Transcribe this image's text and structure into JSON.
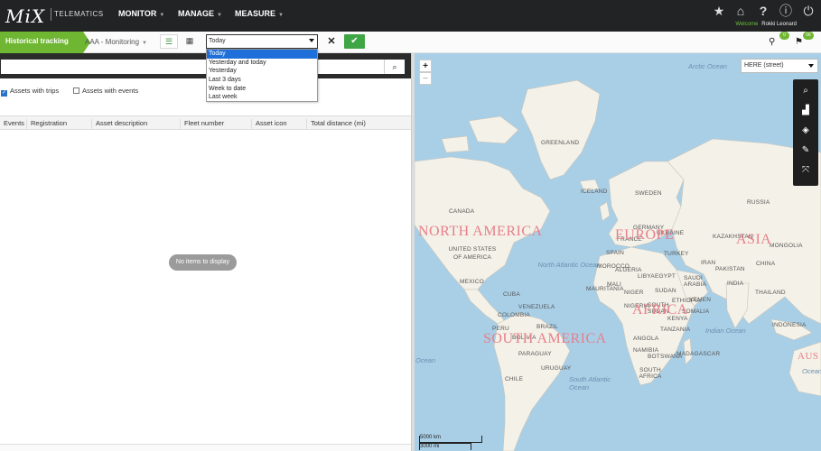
{
  "header": {
    "logo_text": "MiX",
    "logo_sub": "TELEMATICS",
    "nav": [
      {
        "label": "MONITOR"
      },
      {
        "label": "MANAGE"
      },
      {
        "label": "MEASURE"
      }
    ],
    "welcome_label": "Welcome",
    "user_name": "Rokki Leonard",
    "icons": [
      "star-icon",
      "home-icon",
      "help-icon",
      "info-icon",
      "power-icon"
    ]
  },
  "toolbar": {
    "module_title": "Historical tracking",
    "group_select": "AAA - Monitoring",
    "date_select_value": "Today",
    "marker_badge": "0",
    "flag_badge": "06"
  },
  "date_dropdown": {
    "options": [
      "Today",
      "Yesterday and today",
      "Yesterday",
      "Last 3 days",
      "Week to date",
      "Last week"
    ],
    "selected_index": 0
  },
  "left_panel": {
    "search_placeholder": "",
    "filters": [
      {
        "label": "Assets with trips",
        "checked": true
      },
      {
        "label": "Assets with events",
        "checked": false
      }
    ],
    "columns": [
      "Events",
      "Registration",
      "Asset description",
      "Fleet number",
      "Asset icon",
      "Total distance (mi)"
    ],
    "empty_message": "No items to display"
  },
  "map": {
    "layer_select": "HERE (street)",
    "zoom_in": "+",
    "zoom_out": "−",
    "continents": [
      "NORTH AMERICA",
      "EUROPE",
      "ASIA",
      "AFRICA",
      "SOUTH AMERICA",
      "AUS"
    ],
    "oceans": [
      "Arctic Ocean",
      "North Atlantic Ocean",
      "Indian Ocean",
      "South Atlantic Ocean",
      "Ocean",
      "Ocean"
    ],
    "countries": [
      "GREENLAND",
      "ICELAND",
      "SWEDEN",
      "RUSSIA",
      "CANADA",
      "UNITED STATES OF AMERICA",
      "MEXICO",
      "CUBA",
      "COLOMBIA",
      "VENEZUELA",
      "PERU",
      "BRAZIL",
      "BOLIVIA",
      "PARAGUAY",
      "CHILE",
      "URUGUAY",
      "SPAIN",
      "FRANCE",
      "GERMANY",
      "UKRAINE",
      "TURKEY",
      "MOROCCO",
      "ALGERIA",
      "LIBYA",
      "EGYPT",
      "MAURITANIA",
      "MALI",
      "NIGER",
      "SUDAN",
      "NIGERIA",
      "SOUTH SUDAN",
      "ETHIOPIA",
      "SOMALIA",
      "KENYA",
      "TANZANIA",
      "ANGOLA",
      "NAMIBIA",
      "BOTSWANA",
      "MADAGASCAR",
      "SOUTH AFRICA",
      "SAUDI ARABIA",
      "YEMEN",
      "IRAN",
      "PAKISTAN",
      "INDIA",
      "CHINA",
      "MONGOLIA",
      "KAZAKHSTAN",
      "THAILAND",
      "INDONESIA"
    ],
    "scale_km": "5000 km",
    "scale_mi": "3000 mi"
  }
}
